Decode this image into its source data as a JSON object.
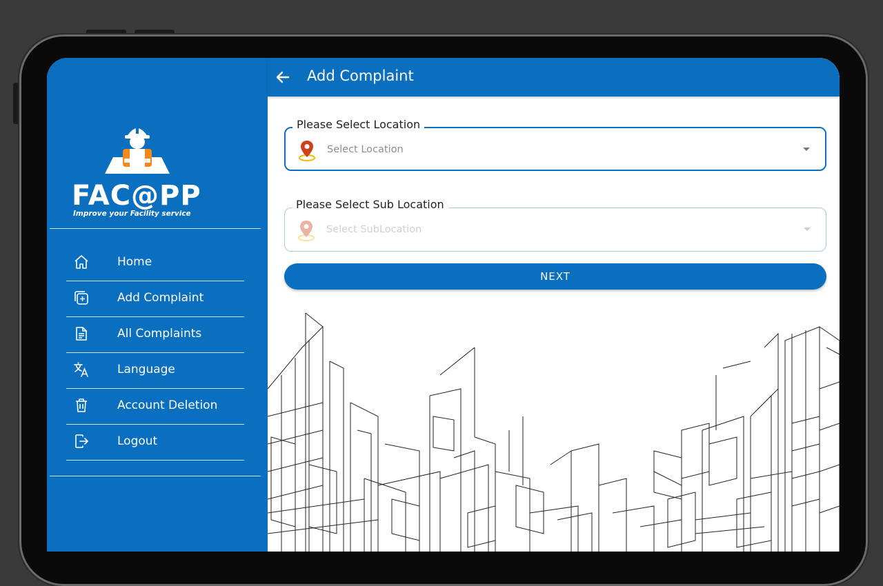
{
  "app": {
    "logo_text": "FAC@PP",
    "logo_tagline": "Improve your Facility service"
  },
  "sidebar": {
    "items": [
      {
        "label": "Home",
        "icon": "home-icon"
      },
      {
        "label": "Add Complaint",
        "icon": "add-square-icon"
      },
      {
        "label": "All Complaints",
        "icon": "document-icon"
      },
      {
        "label": "Language",
        "icon": "translate-icon"
      },
      {
        "label": "Account Deletion",
        "icon": "trash-icon"
      },
      {
        "label": "Logout",
        "icon": "logout-icon"
      }
    ]
  },
  "header": {
    "title": "Add Complaint"
  },
  "form": {
    "location": {
      "label": "Please Select Location",
      "placeholder": "Select Location"
    },
    "sub_location": {
      "label": "Please Select Sub Location",
      "placeholder": "Select SubLocation"
    },
    "next_label": "NEXT"
  },
  "colors": {
    "primary": "#0b6fc0",
    "pin": "#d0401b"
  }
}
